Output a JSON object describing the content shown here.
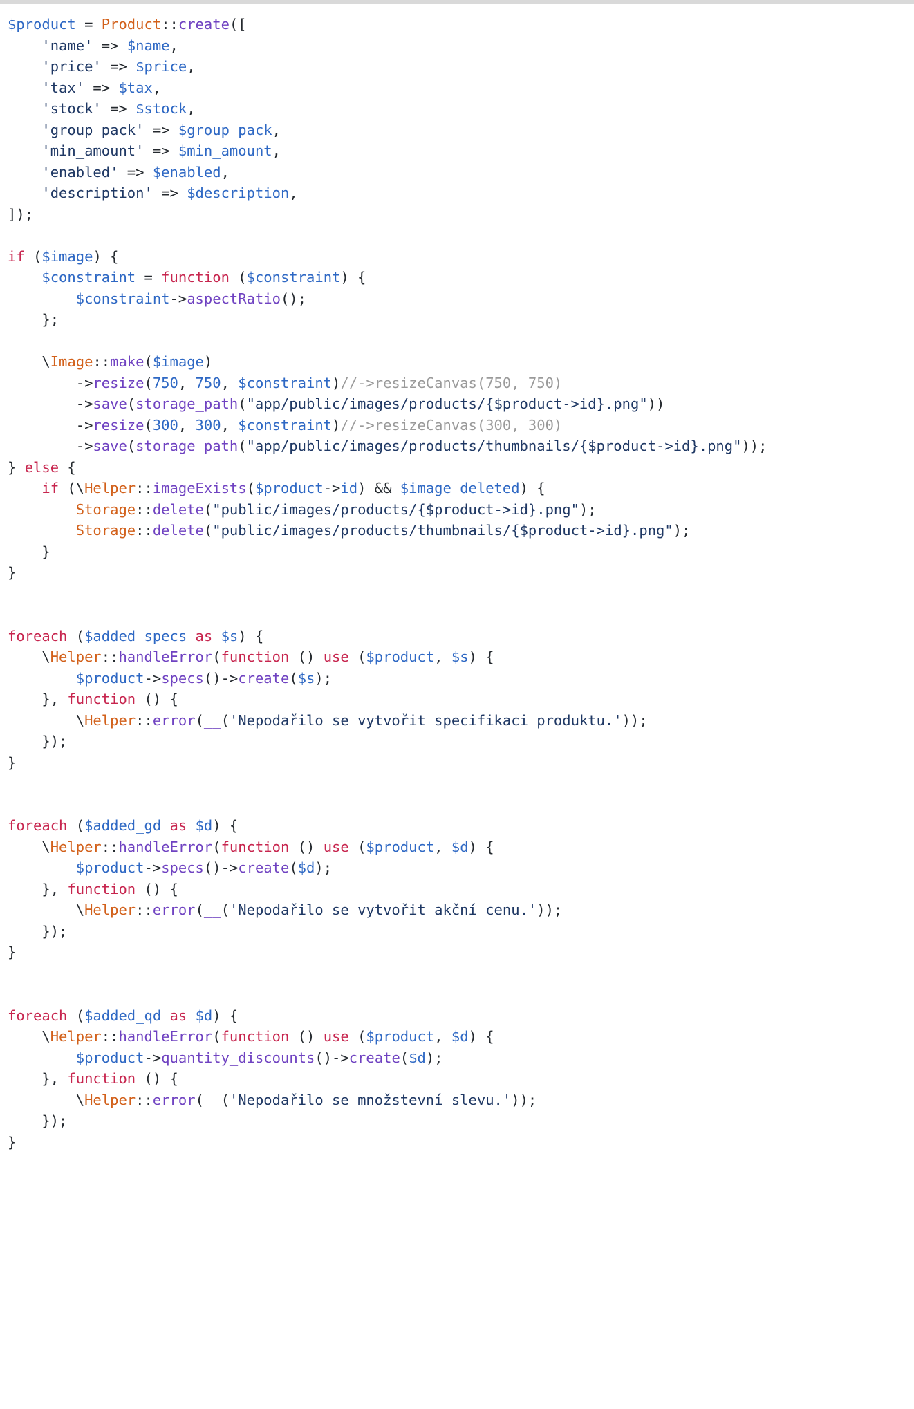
{
  "window": {
    "top_bar_color": "#d9d9d9",
    "background_color": "#ffffff"
  },
  "theme": {
    "variable_color": "#2e68c4",
    "class_color": "#d2601a",
    "function_color": "#6f42c1",
    "keyword_color": "#c7254e",
    "string_color": "#1f3864",
    "number_color": "#2e68c4",
    "comment_color": "#9a9a9a",
    "punctuation_color": "#24292e"
  },
  "code": {
    "language": "php",
    "lines": [
      [
        {
          "t": "$product",
          "c": "var"
        },
        {
          "t": " = ",
          "c": "pun"
        },
        {
          "t": "Product",
          "c": "cls"
        },
        {
          "t": "::",
          "c": "pun"
        },
        {
          "t": "create",
          "c": "fn"
        },
        {
          "t": "([",
          "c": "pun"
        }
      ],
      [
        {
          "t": "    ",
          "c": "pun"
        },
        {
          "t": "'name'",
          "c": "str"
        },
        {
          "t": " => ",
          "c": "pun"
        },
        {
          "t": "$name",
          "c": "var"
        },
        {
          "t": ",",
          "c": "pun"
        }
      ],
      [
        {
          "t": "    ",
          "c": "pun"
        },
        {
          "t": "'price'",
          "c": "str"
        },
        {
          "t": " => ",
          "c": "pun"
        },
        {
          "t": "$price",
          "c": "var"
        },
        {
          "t": ",",
          "c": "pun"
        }
      ],
      [
        {
          "t": "    ",
          "c": "pun"
        },
        {
          "t": "'tax'",
          "c": "str"
        },
        {
          "t": " => ",
          "c": "pun"
        },
        {
          "t": "$tax",
          "c": "var"
        },
        {
          "t": ",",
          "c": "pun"
        }
      ],
      [
        {
          "t": "    ",
          "c": "pun"
        },
        {
          "t": "'stock'",
          "c": "str"
        },
        {
          "t": " => ",
          "c": "pun"
        },
        {
          "t": "$stock",
          "c": "var"
        },
        {
          "t": ",",
          "c": "pun"
        }
      ],
      [
        {
          "t": "    ",
          "c": "pun"
        },
        {
          "t": "'group_pack'",
          "c": "str"
        },
        {
          "t": " => ",
          "c": "pun"
        },
        {
          "t": "$group_pack",
          "c": "var"
        },
        {
          "t": ",",
          "c": "pun"
        }
      ],
      [
        {
          "t": "    ",
          "c": "pun"
        },
        {
          "t": "'min_amount'",
          "c": "str"
        },
        {
          "t": " => ",
          "c": "pun"
        },
        {
          "t": "$min_amount",
          "c": "var"
        },
        {
          "t": ",",
          "c": "pun"
        }
      ],
      [
        {
          "t": "    ",
          "c": "pun"
        },
        {
          "t": "'enabled'",
          "c": "str"
        },
        {
          "t": " => ",
          "c": "pun"
        },
        {
          "t": "$enabled",
          "c": "var"
        },
        {
          "t": ",",
          "c": "pun"
        }
      ],
      [
        {
          "t": "    ",
          "c": "pun"
        },
        {
          "t": "'description'",
          "c": "str"
        },
        {
          "t": " => ",
          "c": "pun"
        },
        {
          "t": "$description",
          "c": "var"
        },
        {
          "t": ",",
          "c": "pun"
        }
      ],
      [
        {
          "t": "]);",
          "c": "pun"
        }
      ],
      [],
      [
        {
          "t": "if",
          "c": "kw"
        },
        {
          "t": " (",
          "c": "pun"
        },
        {
          "t": "$image",
          "c": "var"
        },
        {
          "t": ") {",
          "c": "pun"
        }
      ],
      [
        {
          "t": "    ",
          "c": "pun"
        },
        {
          "t": "$constraint",
          "c": "var"
        },
        {
          "t": " = ",
          "c": "pun"
        },
        {
          "t": "function",
          "c": "kw"
        },
        {
          "t": " (",
          "c": "pun"
        },
        {
          "t": "$constraint",
          "c": "var"
        },
        {
          "t": ") {",
          "c": "pun"
        }
      ],
      [
        {
          "t": "        ",
          "c": "pun"
        },
        {
          "t": "$constraint",
          "c": "var"
        },
        {
          "t": "->",
          "c": "pun"
        },
        {
          "t": "aspectRatio",
          "c": "fn"
        },
        {
          "t": "();",
          "c": "pun"
        }
      ],
      [
        {
          "t": "    };",
          "c": "pun"
        }
      ],
      [],
      [
        {
          "t": "    \\",
          "c": "pun"
        },
        {
          "t": "Image",
          "c": "cls"
        },
        {
          "t": "::",
          "c": "pun"
        },
        {
          "t": "make",
          "c": "fn"
        },
        {
          "t": "(",
          "c": "pun"
        },
        {
          "t": "$image",
          "c": "var"
        },
        {
          "t": ")",
          "c": "pun"
        }
      ],
      [
        {
          "t": "        ->",
          "c": "pun"
        },
        {
          "t": "resize",
          "c": "fn"
        },
        {
          "t": "(",
          "c": "pun"
        },
        {
          "t": "750",
          "c": "num"
        },
        {
          "t": ", ",
          "c": "pun"
        },
        {
          "t": "750",
          "c": "num"
        },
        {
          "t": ", ",
          "c": "pun"
        },
        {
          "t": "$constraint",
          "c": "var"
        },
        {
          "t": ")",
          "c": "pun"
        },
        {
          "t": "//->resizeCanvas(750, 750)",
          "c": "cmt"
        }
      ],
      [
        {
          "t": "        ->",
          "c": "pun"
        },
        {
          "t": "save",
          "c": "fn"
        },
        {
          "t": "(",
          "c": "pun"
        },
        {
          "t": "storage_path",
          "c": "fn"
        },
        {
          "t": "(",
          "c": "pun"
        },
        {
          "t": "\"app/public/images/products/{$product->id}.png\"",
          "c": "str"
        },
        {
          "t": "))",
          "c": "pun"
        }
      ],
      [
        {
          "t": "        ->",
          "c": "pun"
        },
        {
          "t": "resize",
          "c": "fn"
        },
        {
          "t": "(",
          "c": "pun"
        },
        {
          "t": "300",
          "c": "num"
        },
        {
          "t": ", ",
          "c": "pun"
        },
        {
          "t": "300",
          "c": "num"
        },
        {
          "t": ", ",
          "c": "pun"
        },
        {
          "t": "$constraint",
          "c": "var"
        },
        {
          "t": ")",
          "c": "pun"
        },
        {
          "t": "//->resizeCanvas(300, 300)",
          "c": "cmt"
        }
      ],
      [
        {
          "t": "        ->",
          "c": "pun"
        },
        {
          "t": "save",
          "c": "fn"
        },
        {
          "t": "(",
          "c": "pun"
        },
        {
          "t": "storage_path",
          "c": "fn"
        },
        {
          "t": "(",
          "c": "pun"
        },
        {
          "t": "\"app/public/images/products/thumbnails/{$product->id}.png\"",
          "c": "str"
        },
        {
          "t": "));",
          "c": "pun"
        }
      ],
      [
        {
          "t": "} ",
          "c": "pun"
        },
        {
          "t": "else",
          "c": "kw"
        },
        {
          "t": " {",
          "c": "pun"
        }
      ],
      [
        {
          "t": "    ",
          "c": "pun"
        },
        {
          "t": "if",
          "c": "kw"
        },
        {
          "t": " (\\",
          "c": "pun"
        },
        {
          "t": "Helper",
          "c": "cls"
        },
        {
          "t": "::",
          "c": "pun"
        },
        {
          "t": "imageExists",
          "c": "fn"
        },
        {
          "t": "(",
          "c": "pun"
        },
        {
          "t": "$product",
          "c": "var"
        },
        {
          "t": "->",
          "c": "pun"
        },
        {
          "t": "id",
          "c": "prop"
        },
        {
          "t": ") && ",
          "c": "pun"
        },
        {
          "t": "$image_deleted",
          "c": "var"
        },
        {
          "t": ") {",
          "c": "pun"
        }
      ],
      [
        {
          "t": "        ",
          "c": "pun"
        },
        {
          "t": "Storage",
          "c": "cls"
        },
        {
          "t": "::",
          "c": "pun"
        },
        {
          "t": "delete",
          "c": "fn"
        },
        {
          "t": "(",
          "c": "pun"
        },
        {
          "t": "\"public/images/products/{$product->id}.png\"",
          "c": "str"
        },
        {
          "t": ");",
          "c": "pun"
        }
      ],
      [
        {
          "t": "        ",
          "c": "pun"
        },
        {
          "t": "Storage",
          "c": "cls"
        },
        {
          "t": "::",
          "c": "pun"
        },
        {
          "t": "delete",
          "c": "fn"
        },
        {
          "t": "(",
          "c": "pun"
        },
        {
          "t": "\"public/images/products/thumbnails/{$product->id}.png\"",
          "c": "str"
        },
        {
          "t": ");",
          "c": "pun"
        }
      ],
      [
        {
          "t": "    }",
          "c": "pun"
        }
      ],
      [
        {
          "t": "}",
          "c": "pun"
        }
      ],
      [],
      [],
      [
        {
          "t": "foreach",
          "c": "kw"
        },
        {
          "t": " (",
          "c": "pun"
        },
        {
          "t": "$added_specs",
          "c": "var"
        },
        {
          "t": " ",
          "c": "pun"
        },
        {
          "t": "as",
          "c": "kw"
        },
        {
          "t": " ",
          "c": "pun"
        },
        {
          "t": "$s",
          "c": "var"
        },
        {
          "t": ") {",
          "c": "pun"
        }
      ],
      [
        {
          "t": "    \\",
          "c": "pun"
        },
        {
          "t": "Helper",
          "c": "cls"
        },
        {
          "t": "::",
          "c": "pun"
        },
        {
          "t": "handleError",
          "c": "fn"
        },
        {
          "t": "(",
          "c": "pun"
        },
        {
          "t": "function",
          "c": "kw"
        },
        {
          "t": " () ",
          "c": "pun"
        },
        {
          "t": "use",
          "c": "kw"
        },
        {
          "t": " (",
          "c": "pun"
        },
        {
          "t": "$product",
          "c": "var"
        },
        {
          "t": ", ",
          "c": "pun"
        },
        {
          "t": "$s",
          "c": "var"
        },
        {
          "t": ") {",
          "c": "pun"
        }
      ],
      [
        {
          "t": "        ",
          "c": "pun"
        },
        {
          "t": "$product",
          "c": "var"
        },
        {
          "t": "->",
          "c": "pun"
        },
        {
          "t": "specs",
          "c": "fn"
        },
        {
          "t": "()->",
          "c": "pun"
        },
        {
          "t": "create",
          "c": "fn"
        },
        {
          "t": "(",
          "c": "pun"
        },
        {
          "t": "$s",
          "c": "var"
        },
        {
          "t": ");",
          "c": "pun"
        }
      ],
      [
        {
          "t": "    }, ",
          "c": "pun"
        },
        {
          "t": "function",
          "c": "kw"
        },
        {
          "t": " () {",
          "c": "pun"
        }
      ],
      [
        {
          "t": "        \\",
          "c": "pun"
        },
        {
          "t": "Helper",
          "c": "cls"
        },
        {
          "t": "::",
          "c": "pun"
        },
        {
          "t": "error",
          "c": "fn"
        },
        {
          "t": "(",
          "c": "pun"
        },
        {
          "t": "__",
          "c": "fn"
        },
        {
          "t": "(",
          "c": "pun"
        },
        {
          "t": "'Nepodařilo se vytvořit specifikaci produktu.'",
          "c": "str"
        },
        {
          "t": "));",
          "c": "pun"
        }
      ],
      [
        {
          "t": "    });",
          "c": "pun"
        }
      ],
      [
        {
          "t": "}",
          "c": "pun"
        }
      ],
      [],
      [],
      [
        {
          "t": "foreach",
          "c": "kw"
        },
        {
          "t": " (",
          "c": "pun"
        },
        {
          "t": "$added_gd",
          "c": "var"
        },
        {
          "t": " ",
          "c": "pun"
        },
        {
          "t": "as",
          "c": "kw"
        },
        {
          "t": " ",
          "c": "pun"
        },
        {
          "t": "$d",
          "c": "var"
        },
        {
          "t": ") {",
          "c": "pun"
        }
      ],
      [
        {
          "t": "    \\",
          "c": "pun"
        },
        {
          "t": "Helper",
          "c": "cls"
        },
        {
          "t": "::",
          "c": "pun"
        },
        {
          "t": "handleError",
          "c": "fn"
        },
        {
          "t": "(",
          "c": "pun"
        },
        {
          "t": "function",
          "c": "kw"
        },
        {
          "t": " () ",
          "c": "pun"
        },
        {
          "t": "use",
          "c": "kw"
        },
        {
          "t": " (",
          "c": "pun"
        },
        {
          "t": "$product",
          "c": "var"
        },
        {
          "t": ", ",
          "c": "pun"
        },
        {
          "t": "$d",
          "c": "var"
        },
        {
          "t": ") {",
          "c": "pun"
        }
      ],
      [
        {
          "t": "        ",
          "c": "pun"
        },
        {
          "t": "$product",
          "c": "var"
        },
        {
          "t": "->",
          "c": "pun"
        },
        {
          "t": "specs",
          "c": "fn"
        },
        {
          "t": "()->",
          "c": "pun"
        },
        {
          "t": "create",
          "c": "fn"
        },
        {
          "t": "(",
          "c": "pun"
        },
        {
          "t": "$d",
          "c": "var"
        },
        {
          "t": ");",
          "c": "pun"
        }
      ],
      [
        {
          "t": "    }, ",
          "c": "pun"
        },
        {
          "t": "function",
          "c": "kw"
        },
        {
          "t": " () {",
          "c": "pun"
        }
      ],
      [
        {
          "t": "        \\",
          "c": "pun"
        },
        {
          "t": "Helper",
          "c": "cls"
        },
        {
          "t": "::",
          "c": "pun"
        },
        {
          "t": "error",
          "c": "fn"
        },
        {
          "t": "(",
          "c": "pun"
        },
        {
          "t": "__",
          "c": "fn"
        },
        {
          "t": "(",
          "c": "pun"
        },
        {
          "t": "'Nepodařilo se vytvořit akční cenu.'",
          "c": "str"
        },
        {
          "t": "));",
          "c": "pun"
        }
      ],
      [
        {
          "t": "    });",
          "c": "pun"
        }
      ],
      [
        {
          "t": "}",
          "c": "pun"
        }
      ],
      [],
      [],
      [
        {
          "t": "foreach",
          "c": "kw"
        },
        {
          "t": " (",
          "c": "pun"
        },
        {
          "t": "$added_qd",
          "c": "var"
        },
        {
          "t": " ",
          "c": "pun"
        },
        {
          "t": "as",
          "c": "kw"
        },
        {
          "t": " ",
          "c": "pun"
        },
        {
          "t": "$d",
          "c": "var"
        },
        {
          "t": ") {",
          "c": "pun"
        }
      ],
      [
        {
          "t": "    \\",
          "c": "pun"
        },
        {
          "t": "Helper",
          "c": "cls"
        },
        {
          "t": "::",
          "c": "pun"
        },
        {
          "t": "handleError",
          "c": "fn"
        },
        {
          "t": "(",
          "c": "pun"
        },
        {
          "t": "function",
          "c": "kw"
        },
        {
          "t": " () ",
          "c": "pun"
        },
        {
          "t": "use",
          "c": "kw"
        },
        {
          "t": " (",
          "c": "pun"
        },
        {
          "t": "$product",
          "c": "var"
        },
        {
          "t": ", ",
          "c": "pun"
        },
        {
          "t": "$d",
          "c": "var"
        },
        {
          "t": ") {",
          "c": "pun"
        }
      ],
      [
        {
          "t": "        ",
          "c": "pun"
        },
        {
          "t": "$product",
          "c": "var"
        },
        {
          "t": "->",
          "c": "pun"
        },
        {
          "t": "quantity_discounts",
          "c": "fn"
        },
        {
          "t": "()->",
          "c": "pun"
        },
        {
          "t": "create",
          "c": "fn"
        },
        {
          "t": "(",
          "c": "pun"
        },
        {
          "t": "$d",
          "c": "var"
        },
        {
          "t": ");",
          "c": "pun"
        }
      ],
      [
        {
          "t": "    }, ",
          "c": "pun"
        },
        {
          "t": "function",
          "c": "kw"
        },
        {
          "t": " () {",
          "c": "pun"
        }
      ],
      [
        {
          "t": "        \\",
          "c": "pun"
        },
        {
          "t": "Helper",
          "c": "cls"
        },
        {
          "t": "::",
          "c": "pun"
        },
        {
          "t": "error",
          "c": "fn"
        },
        {
          "t": "(",
          "c": "pun"
        },
        {
          "t": "__",
          "c": "fn"
        },
        {
          "t": "(",
          "c": "pun"
        },
        {
          "t": "'Nepodařilo se množstevní slevu.'",
          "c": "str"
        },
        {
          "t": "));",
          "c": "pun"
        }
      ],
      [
        {
          "t": "    });",
          "c": "pun"
        }
      ],
      [
        {
          "t": "}",
          "c": "pun"
        }
      ]
    ]
  }
}
